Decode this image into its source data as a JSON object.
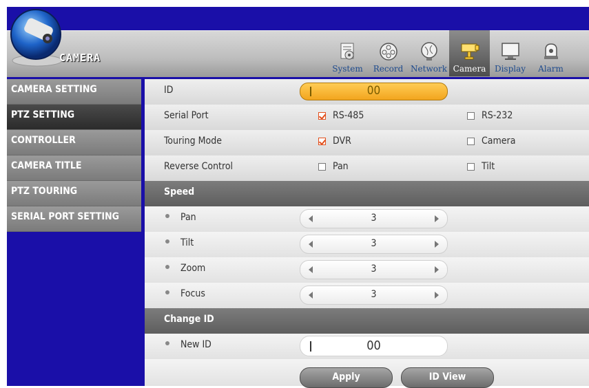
{
  "header": {
    "title": "CAMERA"
  },
  "tabs": [
    {
      "label": "System",
      "icon": "system-icon",
      "active": false
    },
    {
      "label": "Record",
      "icon": "record-reel-icon",
      "active": false
    },
    {
      "label": "Network",
      "icon": "network-icon",
      "active": false
    },
    {
      "label": "Camera",
      "icon": "camera-icon",
      "active": true
    },
    {
      "label": "Display",
      "icon": "display-icon",
      "active": false
    },
    {
      "label": "Alarm",
      "icon": "alarm-icon",
      "active": false
    }
  ],
  "sidebar": {
    "items": [
      {
        "label": "CAMERA SETTING"
      },
      {
        "label": "PTZ SETTING",
        "active": true
      },
      {
        "label": "CONTROLLER"
      },
      {
        "label": "CAMERA TITLE"
      },
      {
        "label": "PTZ TOURING"
      },
      {
        "label": "SERIAL PORT SETTING"
      }
    ]
  },
  "form": {
    "id_label": "ID",
    "id_value": "00",
    "serial_port": {
      "label": "Serial Port",
      "opt1": "RS-485",
      "opt1_checked": true,
      "opt2": "RS-232",
      "opt2_checked": false
    },
    "touring_mode": {
      "label": "Touring Mode",
      "opt1": "DVR",
      "opt1_checked": true,
      "opt2": "Camera",
      "opt2_checked": false
    },
    "reverse_control": {
      "label": "Reverse Control",
      "opt1": "Pan",
      "opt1_checked": false,
      "opt2": "Tilt",
      "opt2_checked": false
    },
    "speed": {
      "title": "Speed",
      "items": [
        {
          "label": "Pan",
          "value": "3"
        },
        {
          "label": "Tilt",
          "value": "3"
        },
        {
          "label": "Zoom",
          "value": "3"
        },
        {
          "label": "Focus",
          "value": "3"
        }
      ]
    },
    "change_id": {
      "title": "Change ID",
      "new_id_label": "New ID",
      "new_id_value": "00"
    },
    "buttons": {
      "apply": "Apply",
      "id_view": "ID View"
    }
  },
  "colors": {
    "frame": "#1a0fa8",
    "check": "#e24f1c",
    "id_field": "#f2a51e"
  }
}
